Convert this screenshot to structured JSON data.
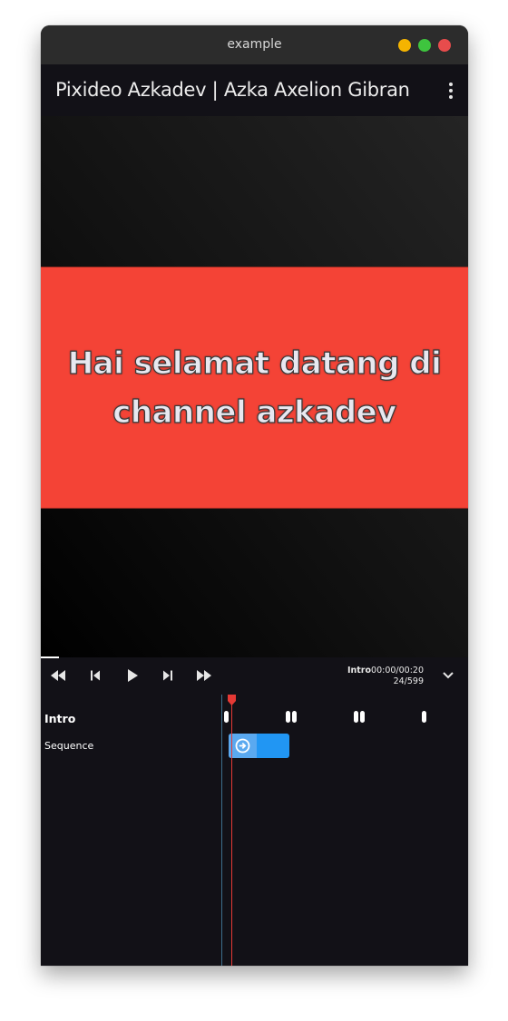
{
  "window": {
    "title": "example",
    "controls": [
      {
        "name": "minimize",
        "color": "#f5b400"
      },
      {
        "name": "maximize",
        "color": "#3ec43e"
      },
      {
        "name": "close",
        "color": "#e74c4c"
      }
    ]
  },
  "appbar": {
    "title": "Pixideo Azkadev | Azka Axelion Gibran",
    "menu_icon": "more-vertical-icon"
  },
  "preview": {
    "slide_text": "Hai selamat datang di channel azkadev",
    "slide_color": "#f44336"
  },
  "player": {
    "buttons": [
      {
        "name": "rewind-button",
        "icon": "rewind-icon"
      },
      {
        "name": "skip-previous-button",
        "icon": "skip-previous-icon"
      },
      {
        "name": "play-button",
        "icon": "play-icon"
      },
      {
        "name": "skip-next-button",
        "icon": "skip-next-icon"
      },
      {
        "name": "fast-forward-button",
        "icon": "fast-forward-icon"
      }
    ],
    "scene_name": "Intro",
    "time": "00:00/00:20",
    "frame": "24/599",
    "expand_icon": "chevron-down-icon"
  },
  "timeline": {
    "tracks": [
      {
        "label": "Intro"
      },
      {
        "label": "Sequence"
      }
    ],
    "sequence_icon": "arrow-right-circle-icon",
    "accent_color": "#2196f3",
    "playhead_color": "#e53935"
  }
}
